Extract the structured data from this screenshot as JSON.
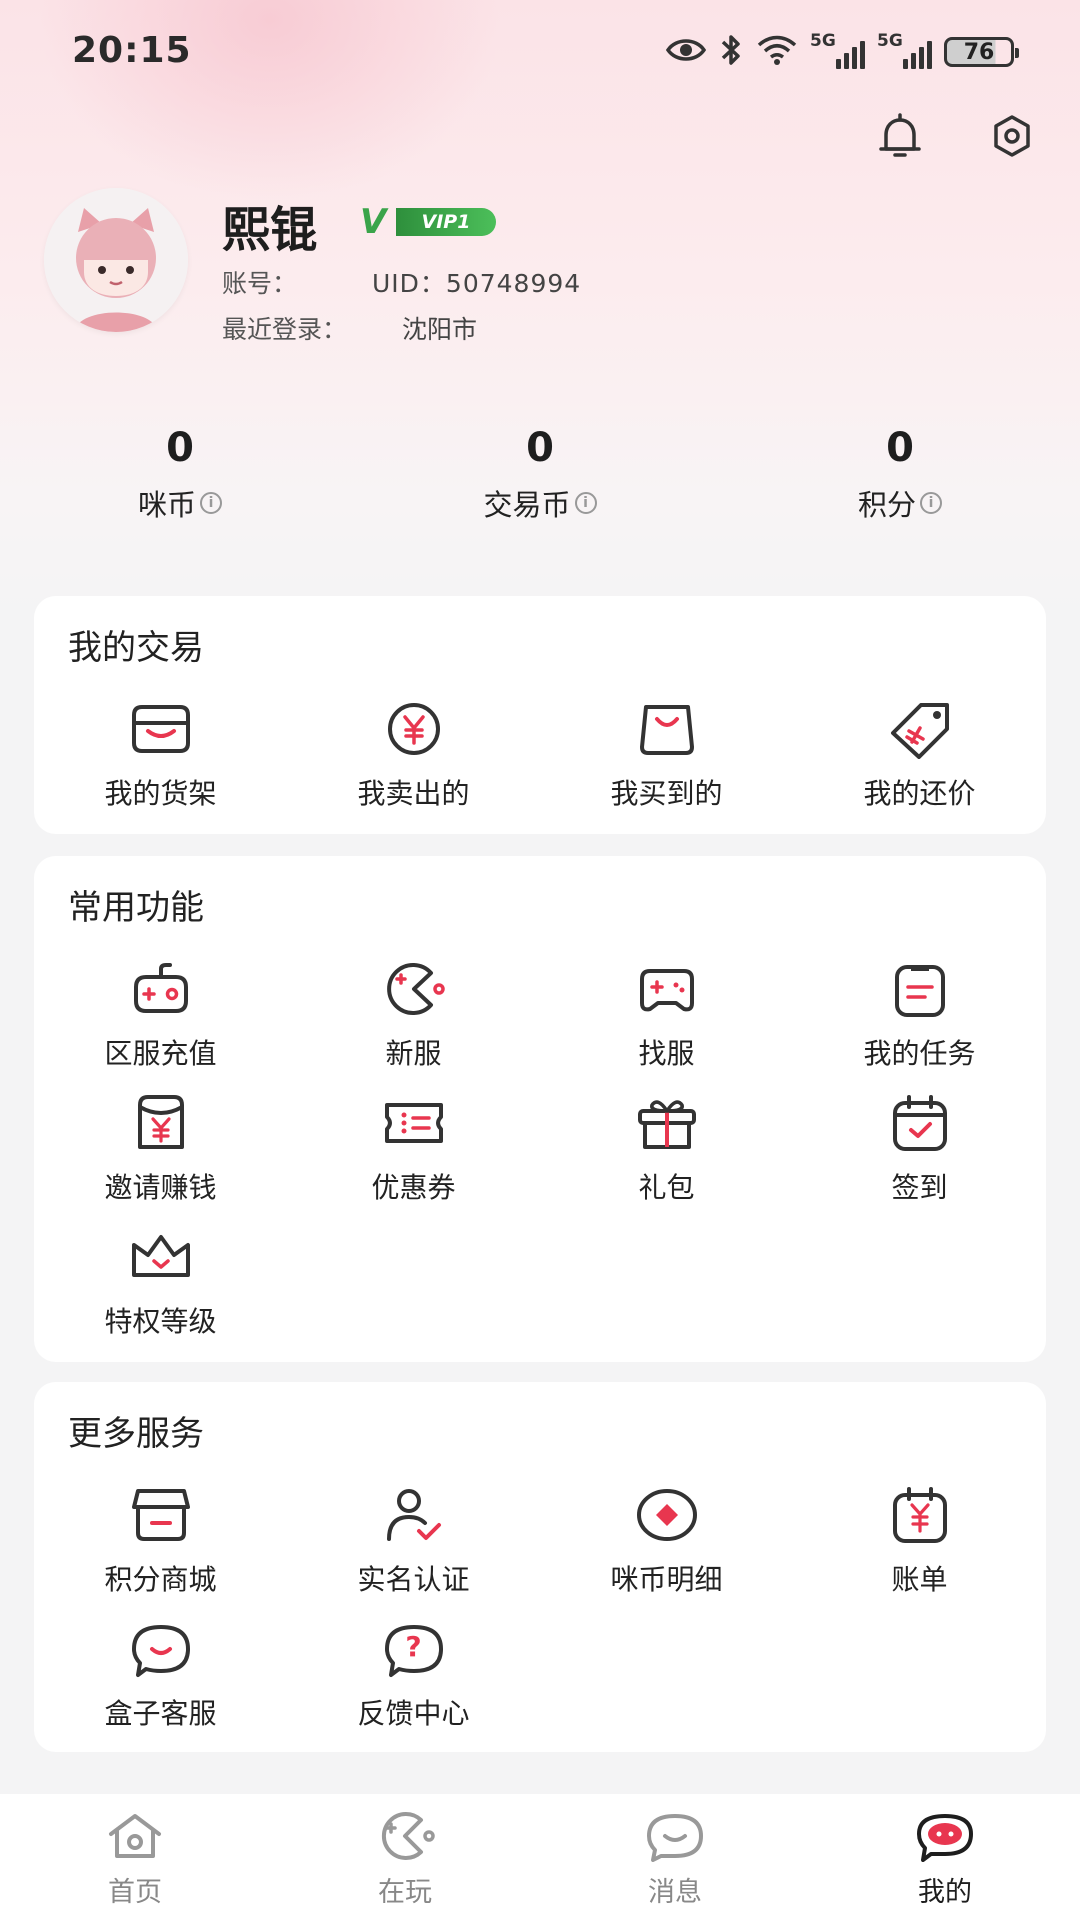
{
  "status_bar": {
    "time": "20:15",
    "signal_label_1": "5G",
    "signal_label_2": "5G",
    "battery": "76",
    "icons": [
      "eye-icon",
      "bluetooth-icon",
      "wifi-icon",
      "signal-icon",
      "signal-icon",
      "battery-icon"
    ]
  },
  "header_icons": [
    "bell-icon",
    "gear-icon"
  ],
  "profile": {
    "name": "熙锟",
    "vip_v": "V",
    "vip_label": "VIP1",
    "account_label": "账号：",
    "uid": "UID：50748994",
    "last_login_label": "最近登录：",
    "last_login_city": "沈阳市"
  },
  "stats": [
    {
      "value": "0",
      "label": "咪币"
    },
    {
      "value": "0",
      "label": "交易币"
    },
    {
      "value": "0",
      "label": "积分"
    }
  ],
  "info_icon_glyph": "i",
  "sections": {
    "trade": {
      "title": "我的交易",
      "items": [
        {
          "label": "我的货架",
          "icon": "shelf-icon"
        },
        {
          "label": "我卖出的",
          "icon": "yen-coin-icon"
        },
        {
          "label": "我买到的",
          "icon": "shopping-bag-icon"
        },
        {
          "label": "我的还价",
          "icon": "price-tag-icon"
        }
      ]
    },
    "common": {
      "title": "常用功能",
      "items": [
        {
          "label": "区服充值",
          "icon": "controller-icon"
        },
        {
          "label": "新服",
          "icon": "pacman-icon"
        },
        {
          "label": "找服",
          "icon": "gamepad-icon"
        },
        {
          "label": "我的任务",
          "icon": "clipboard-icon"
        },
        {
          "label": "邀请赚钱",
          "icon": "red-envelope-icon"
        },
        {
          "label": "优惠券",
          "icon": "coupon-icon"
        },
        {
          "label": "礼包",
          "icon": "gift-icon"
        },
        {
          "label": "签到",
          "icon": "calendar-check-icon"
        },
        {
          "label": "特权等级",
          "icon": "crown-icon"
        }
      ]
    },
    "more": {
      "title": "更多服务",
      "items": [
        {
          "label": "积分商城",
          "icon": "store-icon"
        },
        {
          "label": "实名认证",
          "icon": "user-check-icon"
        },
        {
          "label": "咪币明细",
          "icon": "coin-detail-icon"
        },
        {
          "label": "账单",
          "icon": "bill-icon"
        },
        {
          "label": "盒子客服",
          "icon": "customer-service-icon"
        },
        {
          "label": "反馈中心",
          "icon": "feedback-icon"
        }
      ],
      "feedback_glyph": "?"
    }
  },
  "tabbar": [
    {
      "label": "首页",
      "icon": "home-icon",
      "active": false
    },
    {
      "label": "在玩",
      "icon": "game-icon",
      "active": false
    },
    {
      "label": "消息",
      "icon": "message-icon",
      "active": false
    },
    {
      "label": "我的",
      "icon": "profile-mascot-icon",
      "active": true
    }
  ],
  "colors": {
    "accent": "#e8364f",
    "icon_stroke": "#333333",
    "vip_green": "#3aa44a",
    "hero_pink": "#fbe3e7"
  }
}
